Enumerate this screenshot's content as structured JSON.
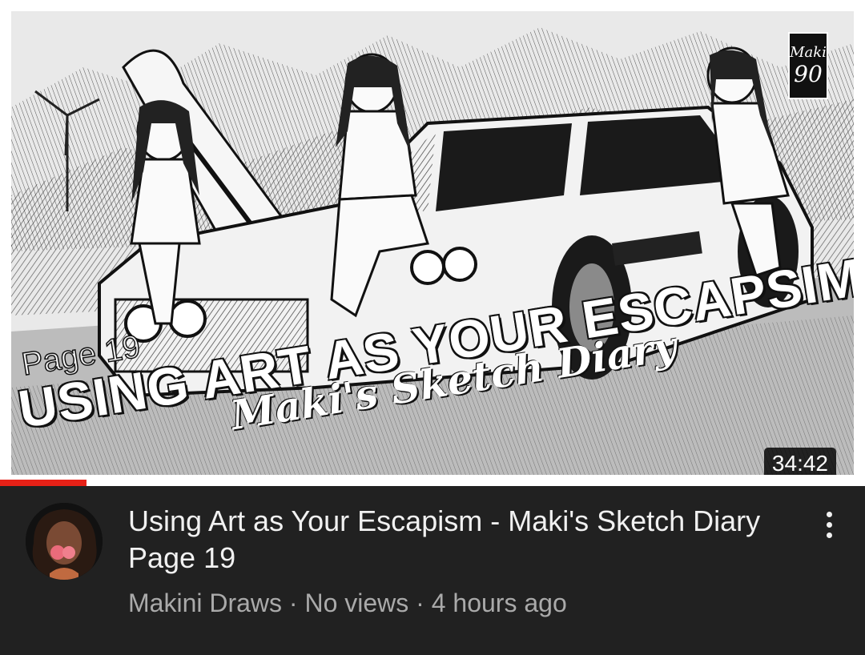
{
  "video": {
    "title": "Using Art as Your Escapism - Maki's Sketch Diary Page 19",
    "duration": "34:42",
    "watched_fraction": 0.1,
    "thumbnail": {
      "page_label": "Page 19",
      "headline": "USING ART AS YOUR ESCAPSIM",
      "subtitle": "Maki's Sketch Diary",
      "logo_text": "Maki",
      "logo_mark": "90"
    }
  },
  "channel": {
    "name": "Makini Draws",
    "avatar_icon": "channel-avatar"
  },
  "meta": {
    "separator": " · ",
    "views": "No views",
    "age": "4 hours ago"
  },
  "menu": {
    "icon": "more-vert-icon"
  },
  "colors": {
    "background": "#212121",
    "title": "#f1f1f1",
    "meta": "#aaaaaa",
    "progress": "#e62117"
  }
}
